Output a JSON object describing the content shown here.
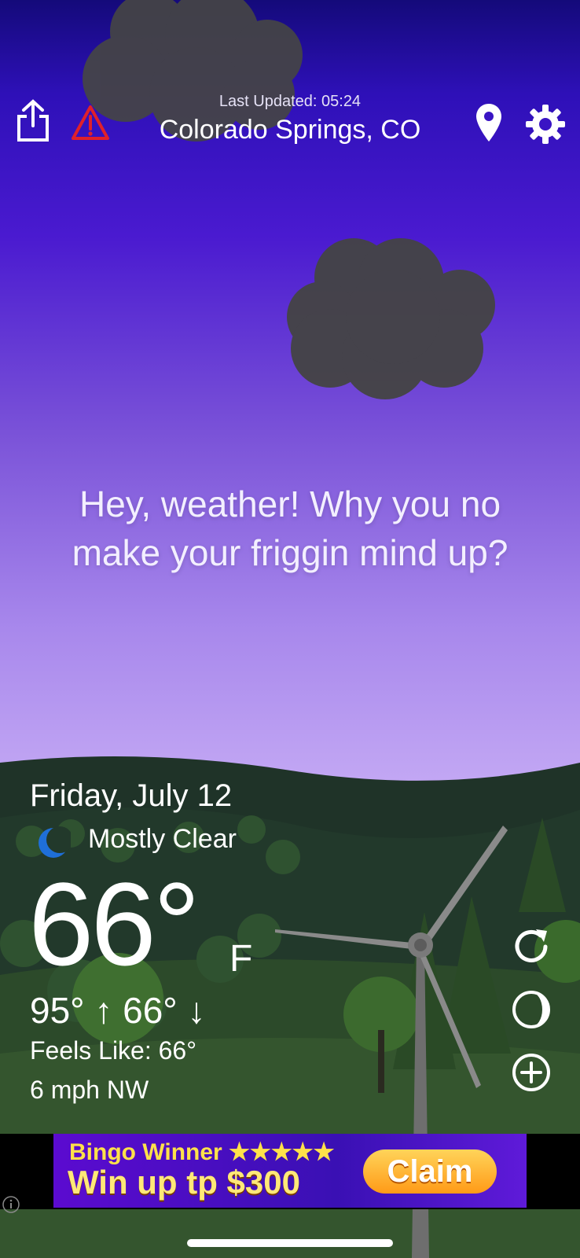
{
  "header": {
    "last_updated": "Last Updated: 05:24",
    "location": "Colorado Springs, CO"
  },
  "tagline": "Hey, weather! Why you no make your friggin mind up?",
  "current": {
    "date": "Friday, July 12",
    "condition": "Mostly Clear",
    "temperature": "66°",
    "unit": "F",
    "high_low": "95° ↑ 66° ↓",
    "feels_like": "Feels Like: 66°",
    "wind": "6 mph NW"
  },
  "ad": {
    "line1": "Bingo Winner ★★★★★",
    "line2": "Win up tp $300",
    "cta": "Claim"
  },
  "colors": {
    "sky_top": "#140a7a",
    "sky_bottom": "#c3a8f4",
    "alert_red": "#e0202a",
    "moon_blue": "#1f6fd8",
    "ground_dark": "#1f3328"
  },
  "icons": {
    "share": "share-icon",
    "alert": "warning-icon",
    "location": "location-pin-icon",
    "settings": "gear-icon",
    "refresh": "refresh-icon",
    "moon_phase": "moon-phase-icon",
    "add": "add-circle-icon",
    "condition": "crescent-moon-icon",
    "ad_info": "info-icon"
  }
}
